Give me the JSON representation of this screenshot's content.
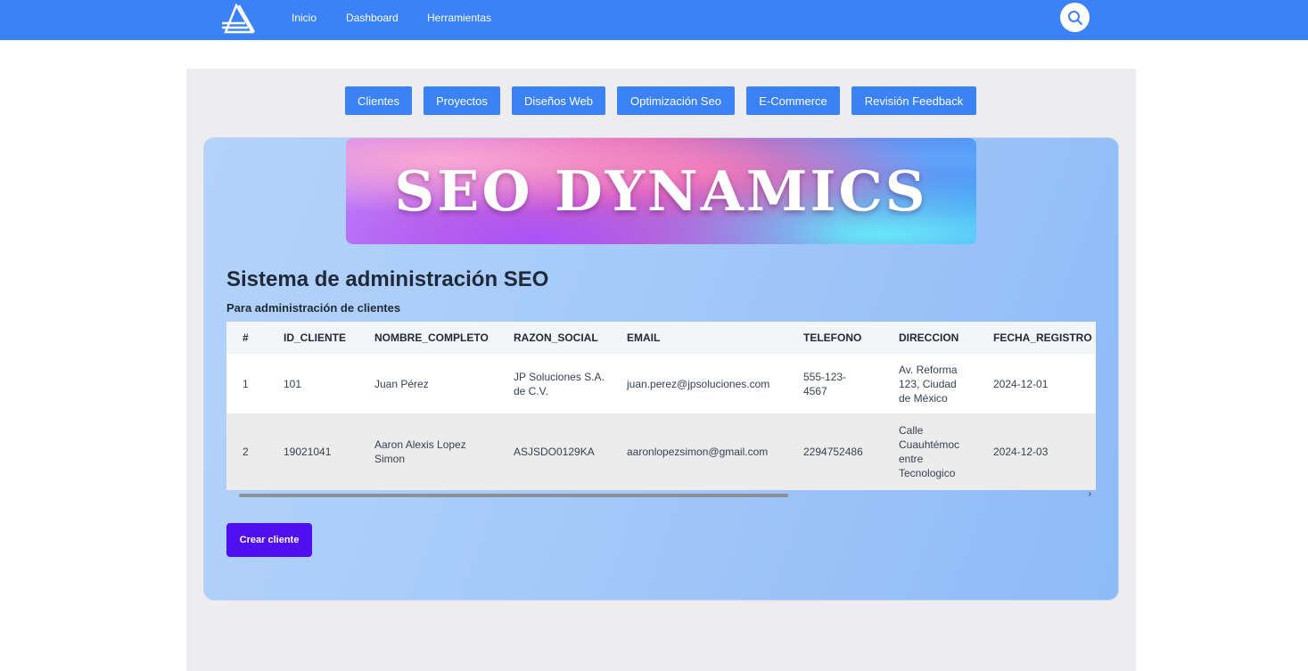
{
  "nav": {
    "links": [
      "Inicio",
      "Dashboard",
      "Herramientas"
    ]
  },
  "tabs": [
    "Clientes",
    "Proyectos",
    "Diseños Web",
    "Optimización Seo",
    "E-Commerce",
    "Revisión Feedback"
  ],
  "banner": {
    "text": "SEO DYNAMICS"
  },
  "main": {
    "title": "Sistema de administración SEO",
    "subtitle": "Para administración de clientes"
  },
  "table": {
    "headers": [
      "#",
      "ID_CLIENTE",
      "NOMBRE_COMPLETO",
      "RAZON_SOCIAL",
      "EMAIL",
      "TELEFONO",
      "DIRECCION",
      "FECHA_REGISTRO"
    ],
    "rows": [
      [
        "1",
        "101",
        "Juan Pérez",
        "JP Soluciones S.A. de C.V.",
        "juan.perez@jpsoluciones.com",
        "555-123-4567",
        "Av. Reforma 123, Ciudad de México",
        "2024-12-01"
      ],
      [
        "2",
        "19021041",
        "Aaron Alexis Lopez Simon",
        "ASJSDO0129KA",
        "aaronlopezsimon@gmail.com",
        "2294752486",
        "Calle Cuauhtémoc entre Tecnologico",
        "2024-12-03"
      ]
    ]
  },
  "actions": {
    "create_label": "Crear cliente"
  },
  "colors": {
    "accent": "#3b82f6",
    "primary_button": "#4f0ff0"
  }
}
